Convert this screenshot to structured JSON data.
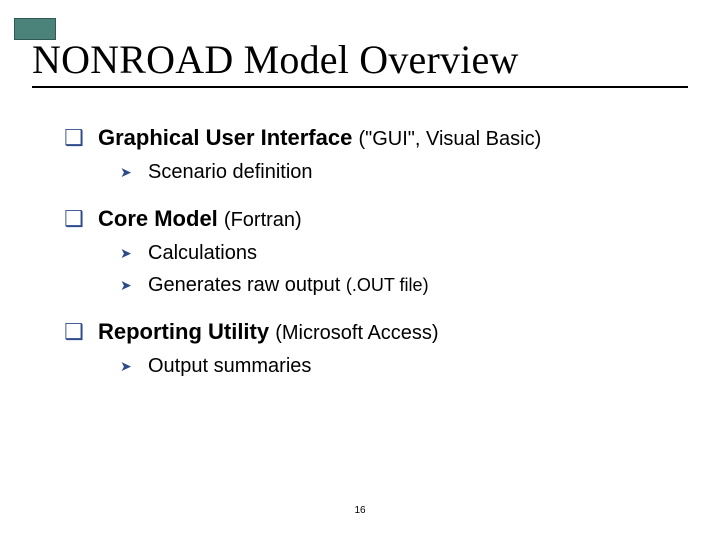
{
  "title": "NONROAD Model Overview",
  "page_number": "16",
  "sections": [
    {
      "heading": "Graphical User Interface",
      "paren": "(\"GUI\", Visual Basic)",
      "items": [
        {
          "text": "Scenario definition",
          "paren": ""
        }
      ]
    },
    {
      "heading": "Core Model",
      "paren": "(Fortran)",
      "items": [
        {
          "text": "Calculations",
          "paren": ""
        },
        {
          "text": "Generates raw output ",
          "paren": "(.OUT file)"
        }
      ]
    },
    {
      "heading": "Reporting Utility",
      "paren": "(Microsoft Access)",
      "items": [
        {
          "text": "Output summaries",
          "paren": ""
        }
      ]
    }
  ]
}
